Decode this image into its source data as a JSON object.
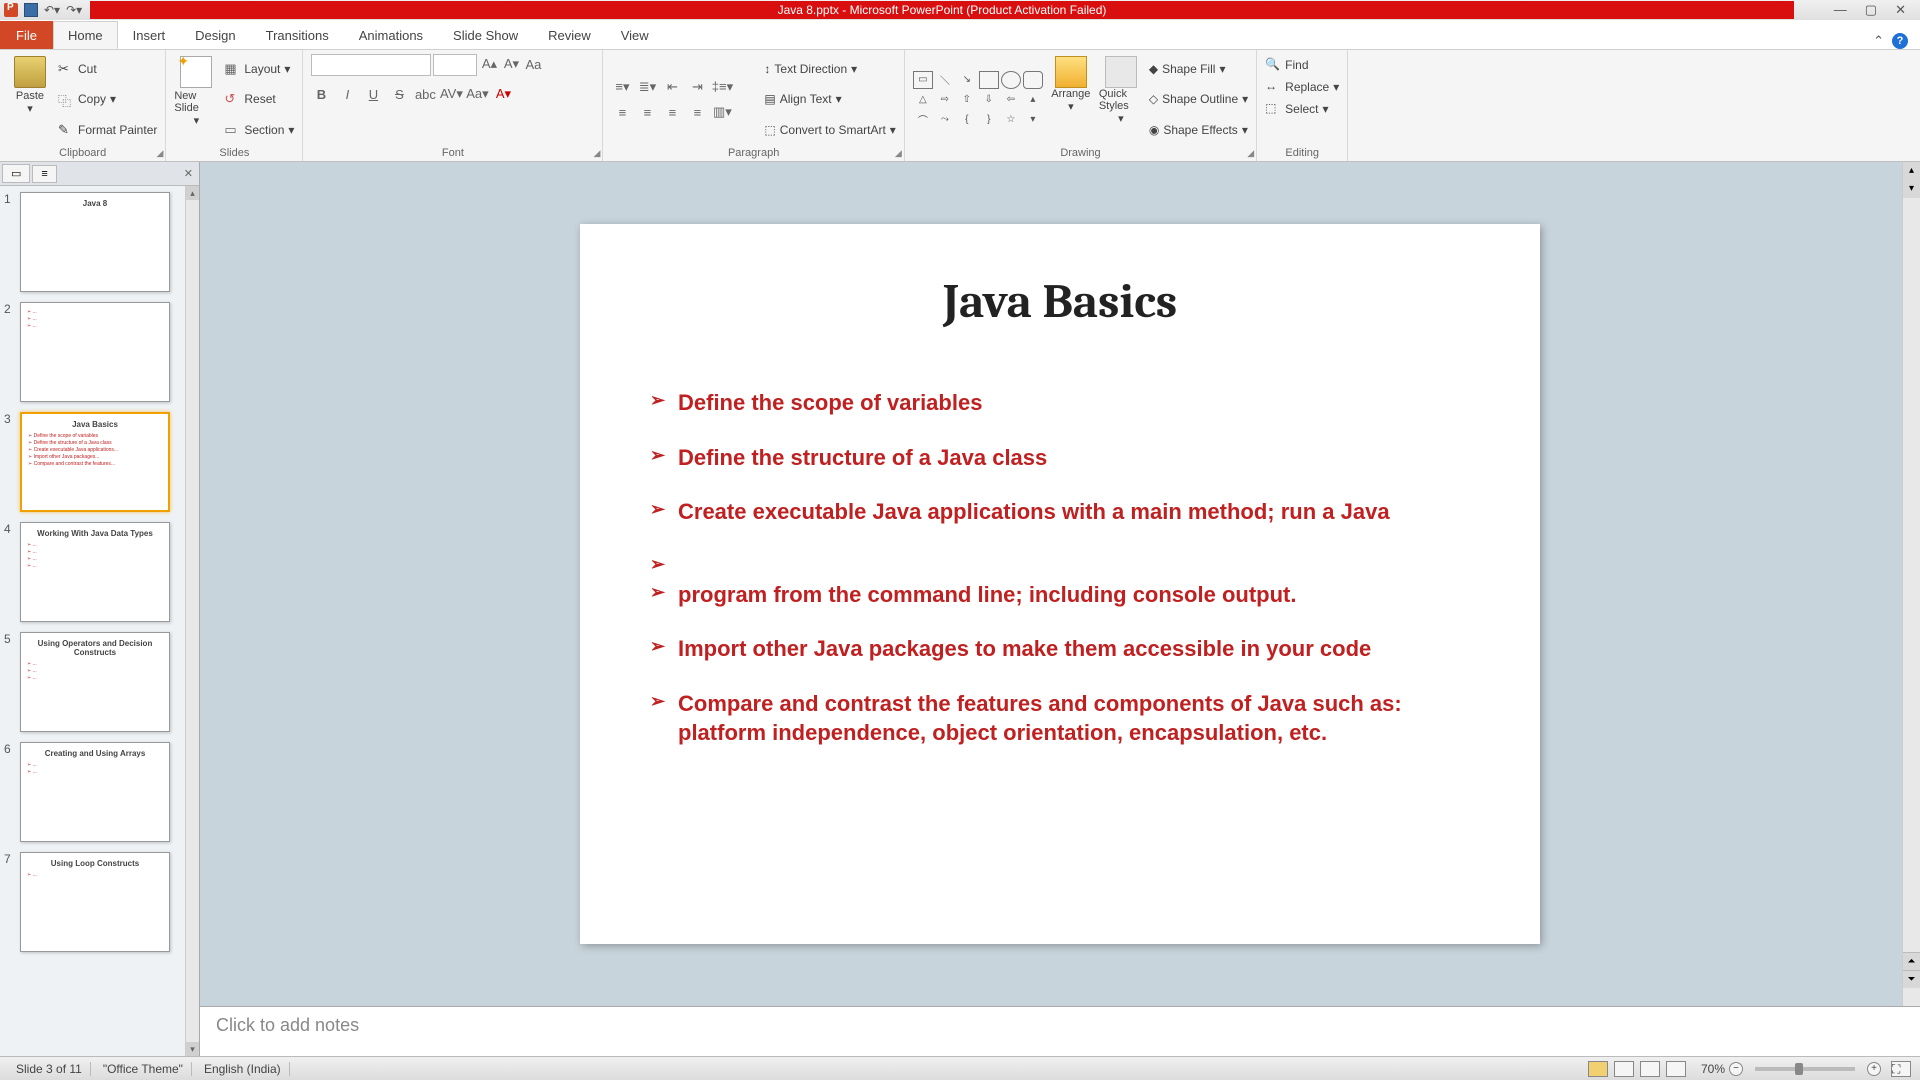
{
  "title": "Java 8.pptx - Microsoft PowerPoint (Product Activation Failed)",
  "tabs": {
    "file": "File",
    "items": [
      "Home",
      "Insert",
      "Design",
      "Transitions",
      "Animations",
      "Slide Show",
      "Review",
      "View"
    ],
    "active": "Home"
  },
  "ribbon": {
    "clipboard": {
      "label": "Clipboard",
      "paste": "Paste",
      "cut": "Cut",
      "copy": "Copy",
      "format_painter": "Format Painter"
    },
    "slides": {
      "label": "Slides",
      "new_slide": "New Slide",
      "layout": "Layout",
      "reset": "Reset",
      "section": "Section"
    },
    "font": {
      "label": "Font"
    },
    "paragraph": {
      "label": "Paragraph",
      "text_direction": "Text Direction",
      "align_text": "Align Text",
      "convert_smartart": "Convert to SmartArt"
    },
    "drawing": {
      "label": "Drawing",
      "arrange": "Arrange",
      "quick_styles": "Quick Styles",
      "shape_fill": "Shape Fill",
      "shape_outline": "Shape Outline",
      "shape_effects": "Shape Effects"
    },
    "editing": {
      "label": "Editing",
      "find": "Find",
      "replace": "Replace",
      "select": "Select"
    }
  },
  "thumbs": [
    {
      "n": 1,
      "title": "Java 8",
      "lines": []
    },
    {
      "n": 2,
      "title": "",
      "lines": [
        "...",
        "...",
        "..."
      ]
    },
    {
      "n": 3,
      "title": "Java Basics",
      "lines": [
        "Define the scope of variables",
        "Define the structure of a Java class",
        "Create executable Java applications...",
        "Import other Java packages...",
        "Compare and contrast the features..."
      ]
    },
    {
      "n": 4,
      "title": "Working With Java Data Types",
      "lines": [
        "...",
        "...",
        "...",
        "..."
      ]
    },
    {
      "n": 5,
      "title": "Using Operators and Decision Constructs",
      "lines": [
        "...",
        "...",
        "..."
      ]
    },
    {
      "n": 6,
      "title": "Creating and Using Arrays",
      "lines": [
        "...",
        "..."
      ]
    },
    {
      "n": 7,
      "title": "Using Loop Constructs",
      "lines": [
        "..."
      ]
    }
  ],
  "selected_thumb": 3,
  "slide": {
    "title": "Java Basics",
    "bullets": [
      "Define the scope of variables",
      "Define the structure of a Java class",
      "Create executable Java applications with a main method; run a Java",
      "",
      "program from the command line; including console output.",
      "Import other Java packages to make them accessible in your code",
      "Compare and contrast the features and components of Java such as: platform independence, object orientation, encapsulation, etc."
    ]
  },
  "notes_placeholder": "Click to add notes",
  "status": {
    "slide_pos": "Slide 3 of 11",
    "theme": "\"Office Theme\"",
    "lang": "English (India)",
    "zoom": "70%"
  }
}
